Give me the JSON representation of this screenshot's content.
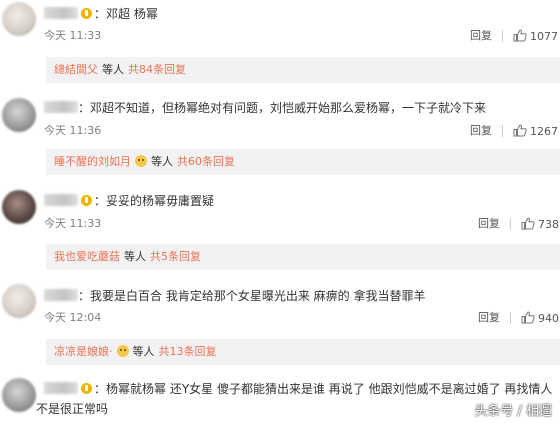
{
  "colors": {
    "link": "#eb7350",
    "reply_bg": "#f2f2f5",
    "meta": "#808080"
  },
  "comments": [
    {
      "text": "：邓超 杨幂",
      "time": "今天 11:33",
      "reply_label": "回复",
      "likes": "1077",
      "reply_summary": {
        "name": "總結間父",
        "etc": "等人",
        "count": "共84条回复"
      }
    },
    {
      "text": "：邓超不知道，但杨幂绝对有问题，刘恺威开始那么爱杨幂，一下子就冷下来",
      "time": "今天 11:36",
      "reply_label": "回复",
      "likes": "1267",
      "reply_summary": {
        "name": "睡不醒的刘如月",
        "etc": "等人",
        "count": "共60条回复"
      }
    },
    {
      "text": "：妥妥的杨幂毋庸置疑",
      "time": "今天 11:33",
      "reply_label": "回复",
      "likes": "738",
      "reply_summary": {
        "name": "我也爱吃蘑菇",
        "etc": "等人",
        "count": "共5条回复"
      }
    },
    {
      "text": "：我要是白百合 我肯定给那个女星曝光出来 麻痹的 拿我当替罪羊",
      "time": "今天 12:04",
      "reply_label": "回复",
      "likes": "940",
      "reply_summary": {
        "name": "凉凉是娘娘·",
        "etc": "等人",
        "count": "共13条回复"
      }
    },
    {
      "text_line1": "：杨幂就杨幂 还Y女星 傻子都能猜出来是谁 再说了 他跟刘恺威不是离过婚了 再找情人",
      "text_line2": "不是很正常吗"
    }
  ],
  "watermark": "头条号 / 相遛"
}
